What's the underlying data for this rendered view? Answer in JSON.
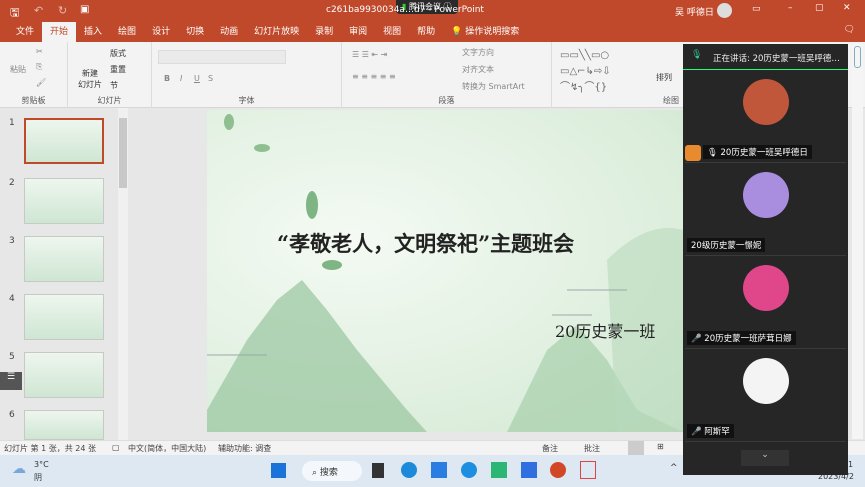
{
  "titlebar": {
    "filename": "c261ba9930034a…d7",
    "separator": "-",
    "app": "PowerPoint",
    "meeting_badge": "腾讯会议",
    "user": "吴 呼德日"
  },
  "tabs": [
    "文件",
    "开始",
    "插入",
    "绘图",
    "设计",
    "切换",
    "动画",
    "幻灯片放映",
    "录制",
    "审阅",
    "视图",
    "帮助",
    "操作说明搜索"
  ],
  "ribbon": {
    "clipboard": {
      "label": "剪贴板",
      "paste": "粘贴"
    },
    "slides": {
      "label": "幻灯片",
      "new": "新建\n幻灯片",
      "layout": "版式",
      "reset": "重置",
      "section": "节"
    },
    "font": {
      "label": "字体",
      "bold": "B",
      "italic": "I",
      "underline": "U",
      "strike": "S"
    },
    "paragraph": {
      "label": "段落",
      "text_direction": "文字方向",
      "align_text": "对齐文本",
      "smartart": "转换为 SmartArt"
    },
    "drawing": {
      "label": "绘图",
      "arrange": "排列"
    }
  },
  "thumbnails": [
    {
      "n": "1",
      "selected": true
    },
    {
      "n": "2"
    },
    {
      "n": "3"
    },
    {
      "n": "4"
    },
    {
      "n": "5"
    },
    {
      "n": "6"
    }
  ],
  "slide": {
    "title": "“孝敬老人，文明祭祀”主题班会",
    "subtitle": "20历史蒙一班"
  },
  "status": {
    "slide_count": "幻灯片 第 1 张，共 24 张",
    "language": "中文(简体，中国大陆)",
    "accessibility": "辅助功能: 调查",
    "notes": "备注",
    "comments": "批注"
  },
  "taskbar": {
    "weather_temp": "3°C",
    "weather_desc": "阴",
    "search": "搜索",
    "time": "1",
    "date": "2023/4/2"
  },
  "meeting": {
    "speaking": "正在讲话: 20历史蒙一班吴呼德…",
    "participants": [
      {
        "name": "20历史蒙一班吴呼德日",
        "color": "#c0573a"
      },
      {
        "name": "20级历史蒙一憬妮",
        "color": "#a98ee0"
      },
      {
        "name": "20历史蒙一班萨茸日娜",
        "color": "#e0468a"
      },
      {
        "name": "阿斯罕",
        "color": "#f4f4f4"
      }
    ]
  },
  "colors": {
    "accent": "#c0492b",
    "meeting_bg": "#262626"
  }
}
